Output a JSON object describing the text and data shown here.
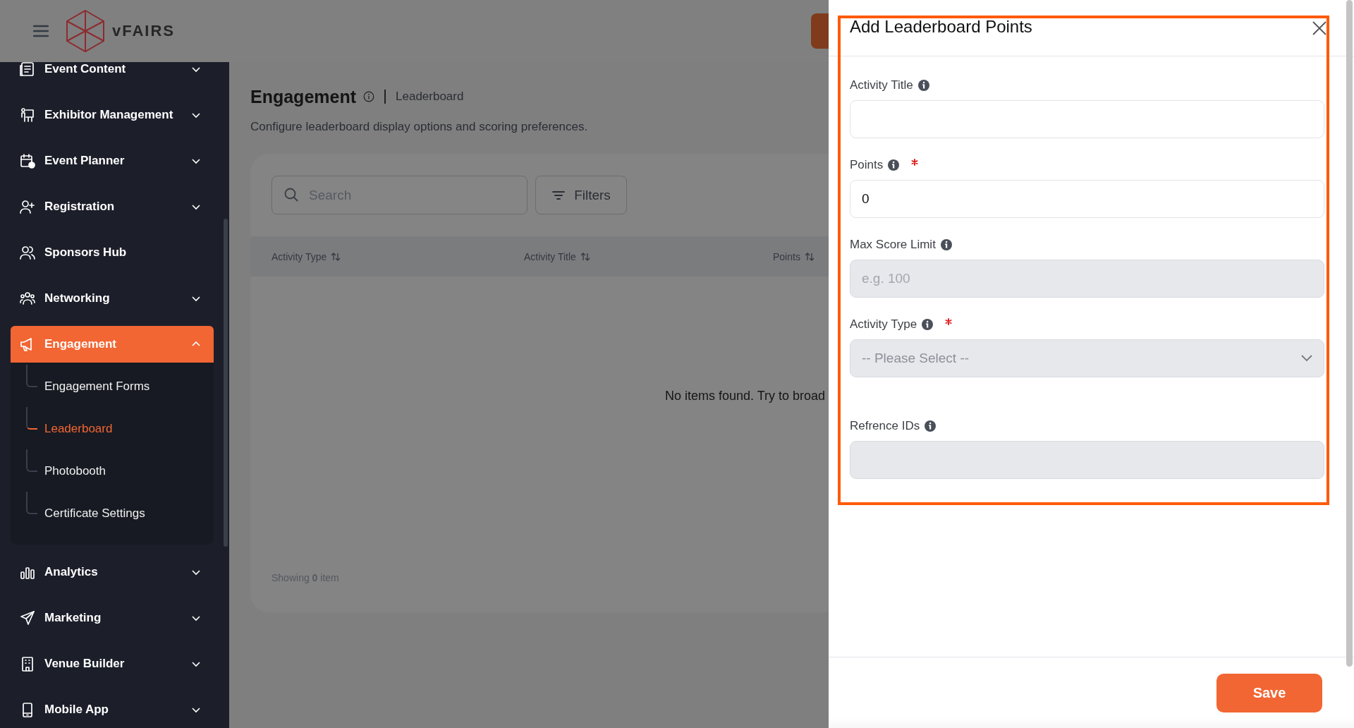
{
  "header": {
    "logo_text": "vFAIRS"
  },
  "sidebar": {
    "items": [
      {
        "label": "Event Content",
        "kind": "group",
        "expanded": false,
        "selected": false
      },
      {
        "label": "Exhibitor Management",
        "kind": "group",
        "expanded": false,
        "selected": false
      },
      {
        "label": "Event Planner",
        "kind": "group",
        "expanded": false,
        "selected": false
      },
      {
        "label": "Registration",
        "kind": "group",
        "expanded": false,
        "selected": false
      },
      {
        "label": "Sponsors Hub",
        "kind": "link",
        "selected": false
      },
      {
        "label": "Networking",
        "kind": "group",
        "expanded": false,
        "selected": false
      },
      {
        "label": "Engagement",
        "kind": "group",
        "expanded": true,
        "selected": true,
        "children": [
          {
            "label": "Engagement Forms",
            "selected": false
          },
          {
            "label": "Leaderboard",
            "selected": true
          },
          {
            "label": "Photobooth",
            "selected": false
          },
          {
            "label": "Certificate Settings",
            "selected": false
          }
        ]
      },
      {
        "label": "Analytics",
        "kind": "group",
        "expanded": false,
        "selected": false
      },
      {
        "label": "Marketing",
        "kind": "group",
        "expanded": false,
        "selected": false
      },
      {
        "label": "Venue Builder",
        "kind": "group",
        "expanded": false,
        "selected": false
      },
      {
        "label": "Mobile App",
        "kind": "group",
        "expanded": false,
        "selected": false
      }
    ]
  },
  "page": {
    "title": "Engagement",
    "breadcrumb": "Leaderboard",
    "description": "Configure leaderboard display options and scoring preferences."
  },
  "toolbar": {
    "search": {
      "placeholder": "Search"
    },
    "filters_button": "Filters"
  },
  "table": {
    "columns": [
      "Activity Type",
      "Activity Title",
      "Points"
    ],
    "empty_message": "No items found. Try to broad",
    "footer": "Showing **0** item"
  },
  "drawer": {
    "title": "Add Leaderboard Points",
    "fields": [
      {
        "label": "Activity Title",
        "kind": "text",
        "required": false,
        "disabled": false
      },
      {
        "label": "Points",
        "kind": "text",
        "required": true,
        "disabled": false,
        "value": "0"
      },
      {
        "label": "Max Score Limit",
        "kind": "text",
        "required": false,
        "disabled": true,
        "placeholder": "e.g. 100"
      },
      {
        "label": "Activity Type",
        "kind": "select",
        "required": true,
        "disabled": true,
        "placeholder": "-- Please Select --"
      },
      {
        "label": "Refrence IDs",
        "kind": "text",
        "required": false,
        "disabled": true
      }
    ],
    "save_button": "Save"
  }
}
